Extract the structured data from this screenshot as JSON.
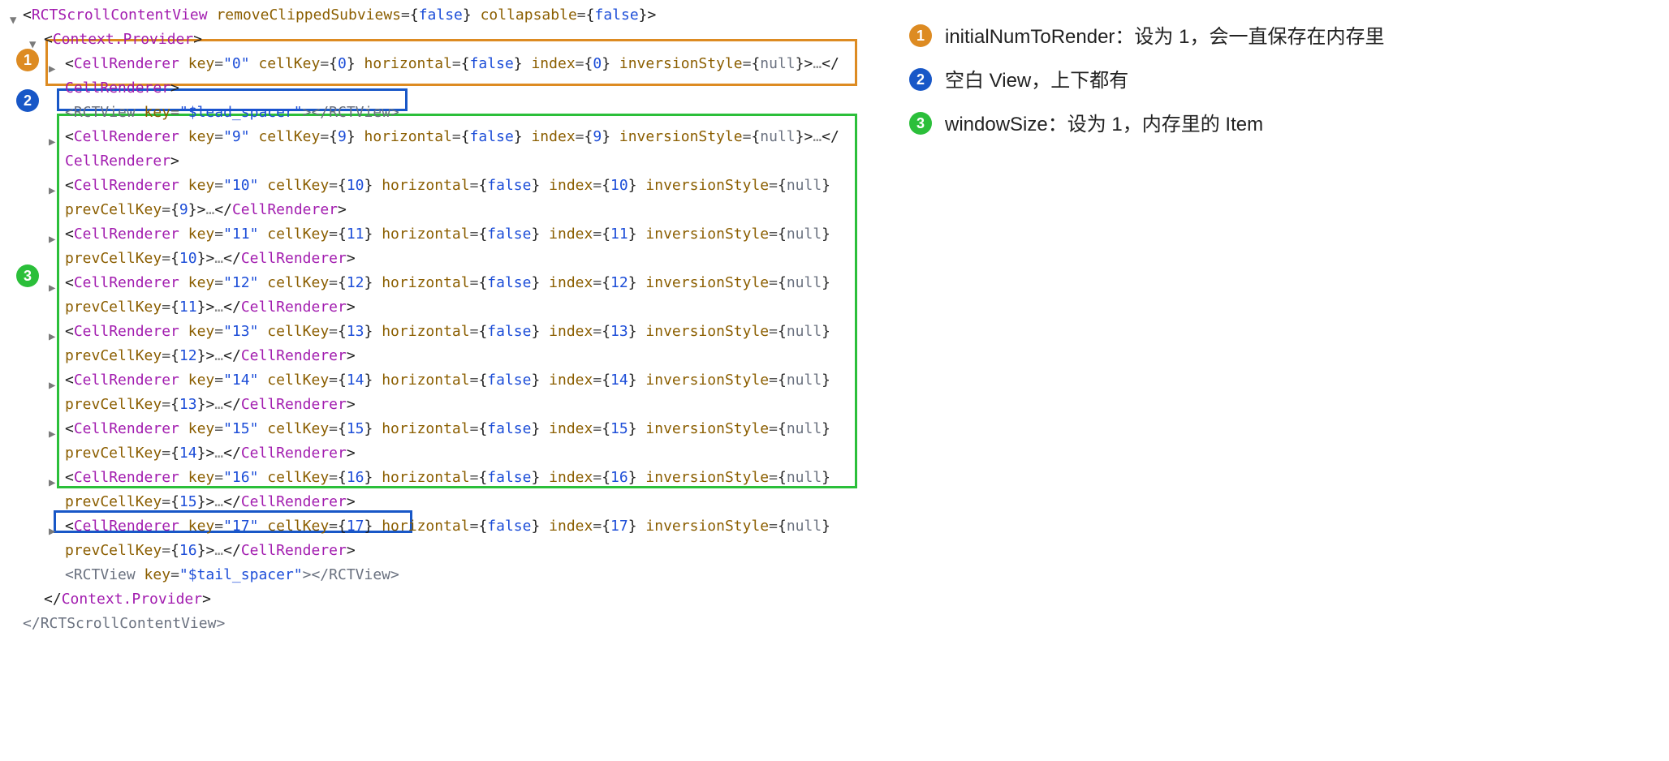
{
  "tree": {
    "root_open": "<RCTScrollContentView ",
    "root_attr1": "removeClippedSubviews",
    "root_attr2": "collapsable",
    "false": "false",
    "provider_open": "Context.Provider",
    "cell_tag": "CellRenderer",
    "rctview_tag": "RCTView",
    "key_attr": "key",
    "cellkey_attr": "cellKey",
    "horiz_attr": "horizontal",
    "index_attr": "index",
    "inv_attr": "inversionStyle",
    "prev_attr": "prevCellKey",
    "null": "null",
    "lead_spacer": "\"$lead_spacer\"",
    "tail_spacer": "\"$tail_spacer\"",
    "ellipsis": "…",
    "close_root": "RCTScrollContentView",
    "rows": [
      {
        "key": "\"0\"",
        "cellKey": "0",
        "index": "0",
        "prev": null
      },
      {
        "key": "\"9\"",
        "cellKey": "9",
        "index": "9",
        "prev": null
      },
      {
        "key": "\"10\"",
        "cellKey": "10",
        "index": "10",
        "prev": "9"
      },
      {
        "key": "\"11\"",
        "cellKey": "11",
        "index": "11",
        "prev": "10"
      },
      {
        "key": "\"12\"",
        "cellKey": "12",
        "index": "12",
        "prev": "11"
      },
      {
        "key": "\"13\"",
        "cellKey": "13",
        "index": "13",
        "prev": "12"
      },
      {
        "key": "\"14\"",
        "cellKey": "14",
        "index": "14",
        "prev": "13"
      },
      {
        "key": "\"15\"",
        "cellKey": "15",
        "index": "15",
        "prev": "14"
      },
      {
        "key": "\"16\"",
        "cellKey": "16",
        "index": "16",
        "prev": "15"
      },
      {
        "key": "\"17\"",
        "cellKey": "17",
        "index": "17",
        "prev": "16"
      }
    ]
  },
  "legend": {
    "1": "initialNumToRender：设为 1，会一直保存在内存里",
    "2": "空白 View，上下都有",
    "3": "windowSize：设为 1，内存里的 Item"
  },
  "badges": {
    "1": "1",
    "2": "2",
    "3": "3"
  }
}
